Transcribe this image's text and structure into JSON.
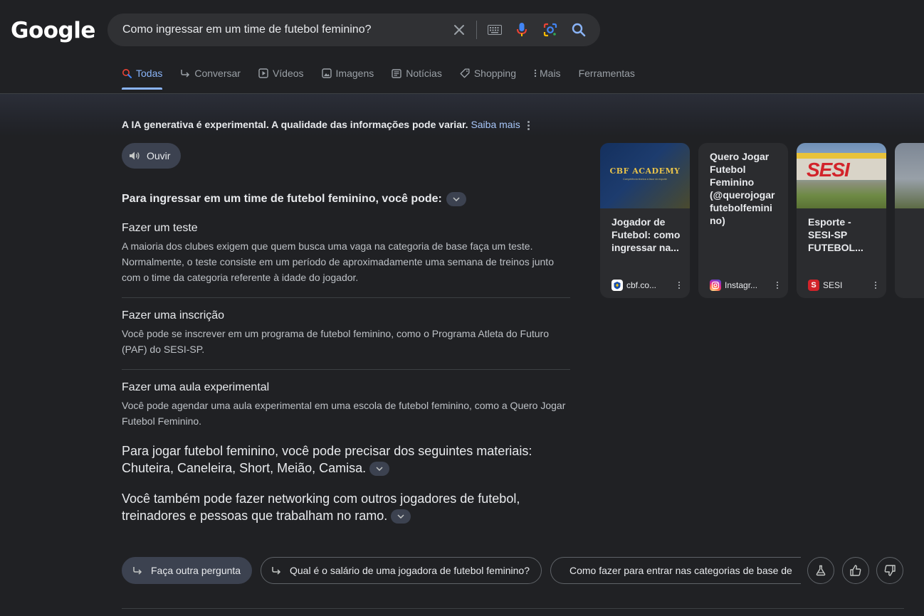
{
  "logo": "Google",
  "search": {
    "query": "Como ingressar em um time de futebol feminino?"
  },
  "tabs": [
    {
      "label": "Todas",
      "icon": "search-icon",
      "active": true
    },
    {
      "label": "Conversar",
      "icon": "reply-arrow-icon"
    },
    {
      "label": "Vídeos",
      "icon": "play-icon"
    },
    {
      "label": "Imagens",
      "icon": "image-icon"
    },
    {
      "label": "Notícias",
      "icon": "news-icon"
    },
    {
      "label": "Shopping",
      "icon": "tag-icon"
    },
    {
      "label": "Mais",
      "icon": "more-vert-icon"
    },
    {
      "label": "Ferramentas",
      "icon": ""
    }
  ],
  "ai": {
    "disclaimer": "A IA generativa é experimental. A qualidade das informações pode variar.",
    "learn_more": "Saiba mais",
    "listen_label": "Ouvir",
    "heading": "Para ingressar em um time de futebol feminino, você pode:",
    "sections": [
      {
        "title": "Fazer um teste",
        "body": "A maioria dos clubes exigem que quem busca uma vaga na categoria de base faça um teste. Normalmente, o teste consiste em um período de aproximadamente uma semana de treinos junto com o time da categoria referente à idade do jogador."
      },
      {
        "title": "Fazer uma inscrição",
        "body": "Você pode se inscrever em um programa de futebol feminino, como o Programa Atleta do Futuro (PAF) do SESI-SP."
      },
      {
        "title": "Fazer uma aula experimental",
        "body": "Você pode agendar uma aula experimental em uma escola de futebol feminino, como a Quero Jogar Futebol Feminino."
      }
    ],
    "para1": "Para jogar futebol feminino, você pode precisar dos seguintes materiais: Chuteira, Caneleira, Short, Meião, Camisa.",
    "para2": "Você também pode fazer networking com outros jogadores de futebol, treinadores e pessoas que trabalham no ramo."
  },
  "cards": [
    {
      "image_text": "CBF ACADEMY",
      "image_sub": "Competência técnica a favor do esporte",
      "title": "Jogador de Futebol: como ingressar na...",
      "source": "cbf.co...",
      "favicon": "cbf-icon"
    },
    {
      "title": "Quero Jogar Futebol Feminino (@querojogar futebolfemini no)",
      "source": "Instagr...",
      "favicon": "instagram-icon"
    },
    {
      "image_text": "SESI",
      "title": "Esporte - SESI-SP FUTEBOL...",
      "source": "SESI",
      "favicon_text": "S"
    }
  ],
  "followups": {
    "primary": "Faça outra pergunta",
    "items": [
      "Qual é o salário de uma jogadora de futebol feminino?",
      "Como fazer para entrar nas categorias de base de"
    ]
  },
  "colors": {
    "bg": "#202124",
    "accent": "#8ab4f8",
    "chip": "#3c4250"
  }
}
